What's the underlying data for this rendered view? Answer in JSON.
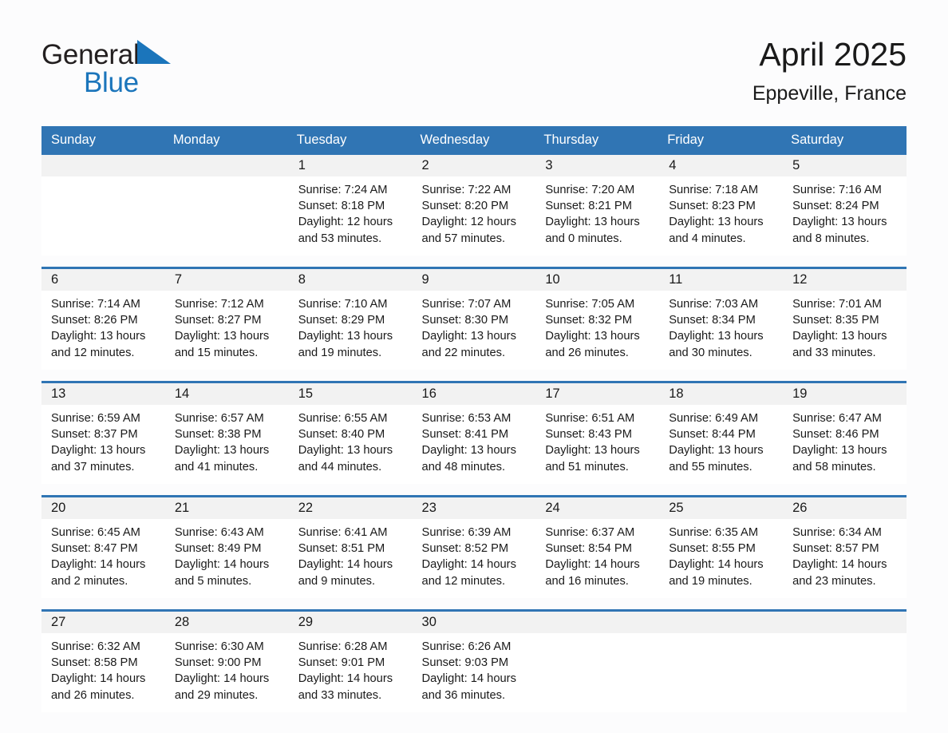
{
  "logo": {
    "word1": "General",
    "word2": "Blue",
    "triangle_color": "#1b75bb"
  },
  "header": {
    "month_title": "April 2025",
    "location": "Eppeville, France"
  },
  "theme": {
    "header_blue": "#3075b4",
    "daynum_background": "#f2f2f2",
    "page_background": "#fcfcfd",
    "text_color": "#1a1a1a"
  },
  "weekday_headers": [
    "Sunday",
    "Monday",
    "Tuesday",
    "Wednesday",
    "Thursday",
    "Friday",
    "Saturday"
  ],
  "weeks": [
    [
      {
        "day": "",
        "sunrise": "",
        "sunset": "",
        "daylight": "",
        "empty": true
      },
      {
        "day": "",
        "sunrise": "",
        "sunset": "",
        "daylight": "",
        "empty": true
      },
      {
        "day": "1",
        "sunrise": "Sunrise: 7:24 AM",
        "sunset": "Sunset: 8:18 PM",
        "daylight": "Daylight: 12 hours and 53 minutes."
      },
      {
        "day": "2",
        "sunrise": "Sunrise: 7:22 AM",
        "sunset": "Sunset: 8:20 PM",
        "daylight": "Daylight: 12 hours and 57 minutes."
      },
      {
        "day": "3",
        "sunrise": "Sunrise: 7:20 AM",
        "sunset": "Sunset: 8:21 PM",
        "daylight": "Daylight: 13 hours and 0 minutes."
      },
      {
        "day": "4",
        "sunrise": "Sunrise: 7:18 AM",
        "sunset": "Sunset: 8:23 PM",
        "daylight": "Daylight: 13 hours and 4 minutes."
      },
      {
        "day": "5",
        "sunrise": "Sunrise: 7:16 AM",
        "sunset": "Sunset: 8:24 PM",
        "daylight": "Daylight: 13 hours and 8 minutes."
      }
    ],
    [
      {
        "day": "6",
        "sunrise": "Sunrise: 7:14 AM",
        "sunset": "Sunset: 8:26 PM",
        "daylight": "Daylight: 13 hours and 12 minutes."
      },
      {
        "day": "7",
        "sunrise": "Sunrise: 7:12 AM",
        "sunset": "Sunset: 8:27 PM",
        "daylight": "Daylight: 13 hours and 15 minutes."
      },
      {
        "day": "8",
        "sunrise": "Sunrise: 7:10 AM",
        "sunset": "Sunset: 8:29 PM",
        "daylight": "Daylight: 13 hours and 19 minutes."
      },
      {
        "day": "9",
        "sunrise": "Sunrise: 7:07 AM",
        "sunset": "Sunset: 8:30 PM",
        "daylight": "Daylight: 13 hours and 22 minutes."
      },
      {
        "day": "10",
        "sunrise": "Sunrise: 7:05 AM",
        "sunset": "Sunset: 8:32 PM",
        "daylight": "Daylight: 13 hours and 26 minutes."
      },
      {
        "day": "11",
        "sunrise": "Sunrise: 7:03 AM",
        "sunset": "Sunset: 8:34 PM",
        "daylight": "Daylight: 13 hours and 30 minutes."
      },
      {
        "day": "12",
        "sunrise": "Sunrise: 7:01 AM",
        "sunset": "Sunset: 8:35 PM",
        "daylight": "Daylight: 13 hours and 33 minutes."
      }
    ],
    [
      {
        "day": "13",
        "sunrise": "Sunrise: 6:59 AM",
        "sunset": "Sunset: 8:37 PM",
        "daylight": "Daylight: 13 hours and 37 minutes."
      },
      {
        "day": "14",
        "sunrise": "Sunrise: 6:57 AM",
        "sunset": "Sunset: 8:38 PM",
        "daylight": "Daylight: 13 hours and 41 minutes."
      },
      {
        "day": "15",
        "sunrise": "Sunrise: 6:55 AM",
        "sunset": "Sunset: 8:40 PM",
        "daylight": "Daylight: 13 hours and 44 minutes."
      },
      {
        "day": "16",
        "sunrise": "Sunrise: 6:53 AM",
        "sunset": "Sunset: 8:41 PM",
        "daylight": "Daylight: 13 hours and 48 minutes."
      },
      {
        "day": "17",
        "sunrise": "Sunrise: 6:51 AM",
        "sunset": "Sunset: 8:43 PM",
        "daylight": "Daylight: 13 hours and 51 minutes."
      },
      {
        "day": "18",
        "sunrise": "Sunrise: 6:49 AM",
        "sunset": "Sunset: 8:44 PM",
        "daylight": "Daylight: 13 hours and 55 minutes."
      },
      {
        "day": "19",
        "sunrise": "Sunrise: 6:47 AM",
        "sunset": "Sunset: 8:46 PM",
        "daylight": "Daylight: 13 hours and 58 minutes."
      }
    ],
    [
      {
        "day": "20",
        "sunrise": "Sunrise: 6:45 AM",
        "sunset": "Sunset: 8:47 PM",
        "daylight": "Daylight: 14 hours and 2 minutes."
      },
      {
        "day": "21",
        "sunrise": "Sunrise: 6:43 AM",
        "sunset": "Sunset: 8:49 PM",
        "daylight": "Daylight: 14 hours and 5 minutes."
      },
      {
        "day": "22",
        "sunrise": "Sunrise: 6:41 AM",
        "sunset": "Sunset: 8:51 PM",
        "daylight": "Daylight: 14 hours and 9 minutes."
      },
      {
        "day": "23",
        "sunrise": "Sunrise: 6:39 AM",
        "sunset": "Sunset: 8:52 PM",
        "daylight": "Daylight: 14 hours and 12 minutes."
      },
      {
        "day": "24",
        "sunrise": "Sunrise: 6:37 AM",
        "sunset": "Sunset: 8:54 PM",
        "daylight": "Daylight: 14 hours and 16 minutes."
      },
      {
        "day": "25",
        "sunrise": "Sunrise: 6:35 AM",
        "sunset": "Sunset: 8:55 PM",
        "daylight": "Daylight: 14 hours and 19 minutes."
      },
      {
        "day": "26",
        "sunrise": "Sunrise: 6:34 AM",
        "sunset": "Sunset: 8:57 PM",
        "daylight": "Daylight: 14 hours and 23 minutes."
      }
    ],
    [
      {
        "day": "27",
        "sunrise": "Sunrise: 6:32 AM",
        "sunset": "Sunset: 8:58 PM",
        "daylight": "Daylight: 14 hours and 26 minutes."
      },
      {
        "day": "28",
        "sunrise": "Sunrise: 6:30 AM",
        "sunset": "Sunset: 9:00 PM",
        "daylight": "Daylight: 14 hours and 29 minutes."
      },
      {
        "day": "29",
        "sunrise": "Sunrise: 6:28 AM",
        "sunset": "Sunset: 9:01 PM",
        "daylight": "Daylight: 14 hours and 33 minutes."
      },
      {
        "day": "30",
        "sunrise": "Sunrise: 6:26 AM",
        "sunset": "Sunset: 9:03 PM",
        "daylight": "Daylight: 14 hours and 36 minutes."
      },
      {
        "day": "",
        "sunrise": "",
        "sunset": "",
        "daylight": "",
        "empty": true
      },
      {
        "day": "",
        "sunrise": "",
        "sunset": "",
        "daylight": "",
        "empty": true
      },
      {
        "day": "",
        "sunrise": "",
        "sunset": "",
        "daylight": "",
        "empty": true
      }
    ]
  ]
}
